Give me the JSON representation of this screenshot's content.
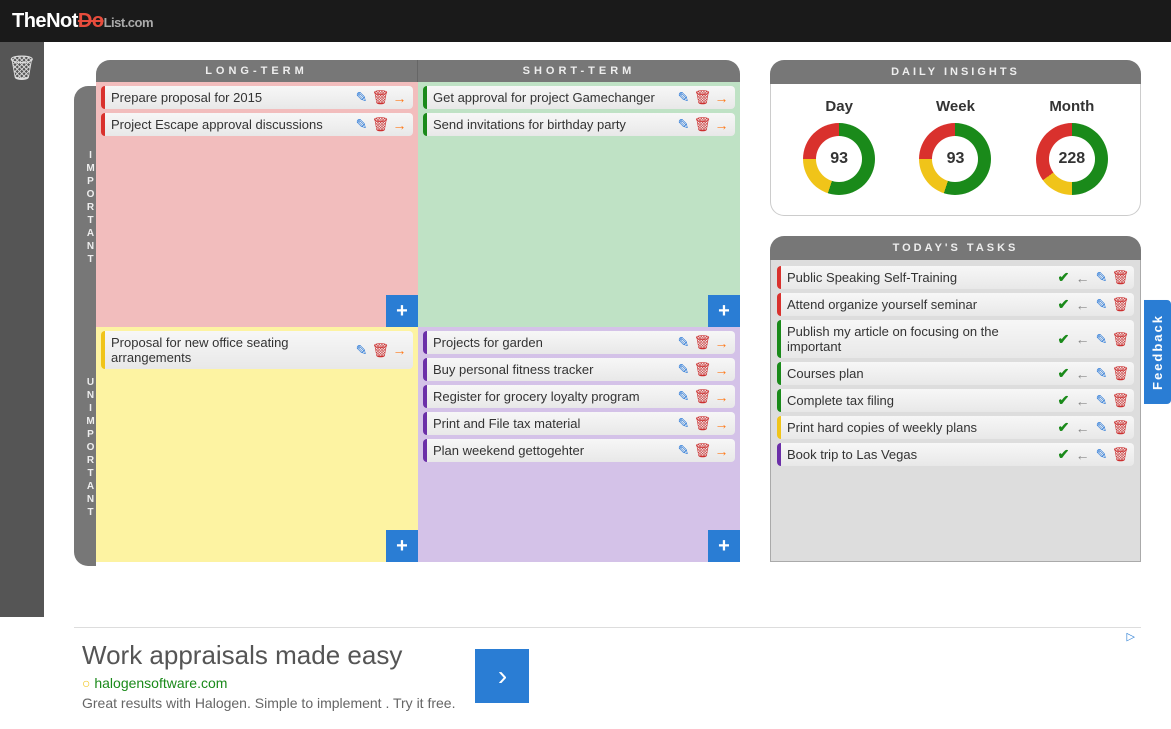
{
  "brand": {
    "the": "The",
    "not": "Not",
    "do": "Do",
    "list": "List",
    "com": ".com"
  },
  "cols": {
    "long": "LONG-TERM",
    "short": "SHORT-TERM"
  },
  "rows": {
    "imp": "IMPORTANT",
    "unimp": "UNIMPORTANT"
  },
  "q1": [
    {
      "t": "Prepare proposal for 2015",
      "c": "red"
    },
    {
      "t": "Project Escape approval discussions",
      "c": "red"
    }
  ],
  "q2": [
    {
      "t": "Get approval for project Gamechanger",
      "c": "green"
    },
    {
      "t": "Send invitations for birthday party",
      "c": "green"
    }
  ],
  "q3": [
    {
      "t": "Proposal for new office seating arrangements",
      "c": "yellow"
    }
  ],
  "q4": [
    {
      "t": "Projects for garden",
      "c": "purple"
    },
    {
      "t": "Buy personal fitness tracker",
      "c": "purple"
    },
    {
      "t": "Register for grocery loyalty program",
      "c": "purple"
    },
    {
      "t": "Print and File tax material",
      "c": "purple"
    },
    {
      "t": "Plan weekend gettogehter",
      "c": "purple"
    }
  ],
  "insights": {
    "title": "DAILY INSIGHTS",
    "items": [
      {
        "label": "Day",
        "value": "93",
        "seg": [
          55,
          20,
          25
        ]
      },
      {
        "label": "Week",
        "value": "93",
        "seg": [
          55,
          20,
          25
        ]
      },
      {
        "label": "Month",
        "value": "228",
        "seg": [
          50,
          15,
          35
        ]
      }
    ]
  },
  "today": {
    "title": "TODAY'S TASKS",
    "items": [
      {
        "t": "Public Speaking Self-Training",
        "c": "red"
      },
      {
        "t": "Attend organize yourself seminar",
        "c": "red"
      },
      {
        "t": "Publish my article on focusing on the important",
        "c": "green"
      },
      {
        "t": "Courses plan",
        "c": "green"
      },
      {
        "t": "Complete tax filing",
        "c": "green"
      },
      {
        "t": "Print hard copies of weekly plans",
        "c": "yellow"
      },
      {
        "t": "Book trip to Las Vegas",
        "c": "purple"
      }
    ]
  },
  "feedback": "Feedback",
  "ad": {
    "title": "Work appraisals made easy",
    "url": "halogensoftware.com",
    "desc": "Great results with Halogen. Simple to implement . Try it free."
  }
}
